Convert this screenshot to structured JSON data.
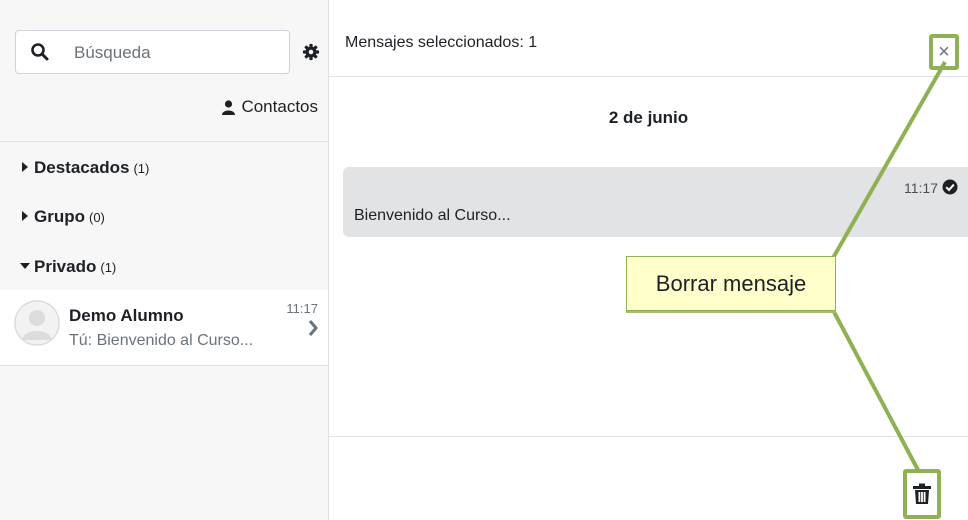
{
  "sidebar": {
    "search": {
      "placeholder": "Búsqueda",
      "value": ""
    },
    "contacts_label": "Contactos",
    "sections": [
      {
        "label": "Destacados",
        "count": "(1)",
        "expanded": false
      },
      {
        "label": "Grupo",
        "count": "(0)",
        "expanded": false
      },
      {
        "label": "Privado",
        "count": "(1)",
        "expanded": true
      }
    ],
    "conversation": {
      "name": "Demo Alumno",
      "preview": "Tú: Bienvenido al Curso...",
      "time": "11:17"
    }
  },
  "main": {
    "header_title": "Mensajes seleccionados: 1",
    "close_label": "×",
    "date_label": "2 de junio",
    "message": {
      "time": "11:17",
      "text": "Bienvenido al Curso..."
    }
  },
  "callout": {
    "label": "Borrar mensaje"
  },
  "icons": [
    "search-icon",
    "gear-icon",
    "user-icon",
    "caret-right-icon",
    "caret-down-icon",
    "chevron-right-icon",
    "check-circle-icon",
    "close-icon",
    "trash-icon"
  ],
  "colors": {
    "highlight_border": "#8db153",
    "callout_bg": "#ffffcc",
    "bubble_bg": "#e2e3e5"
  }
}
